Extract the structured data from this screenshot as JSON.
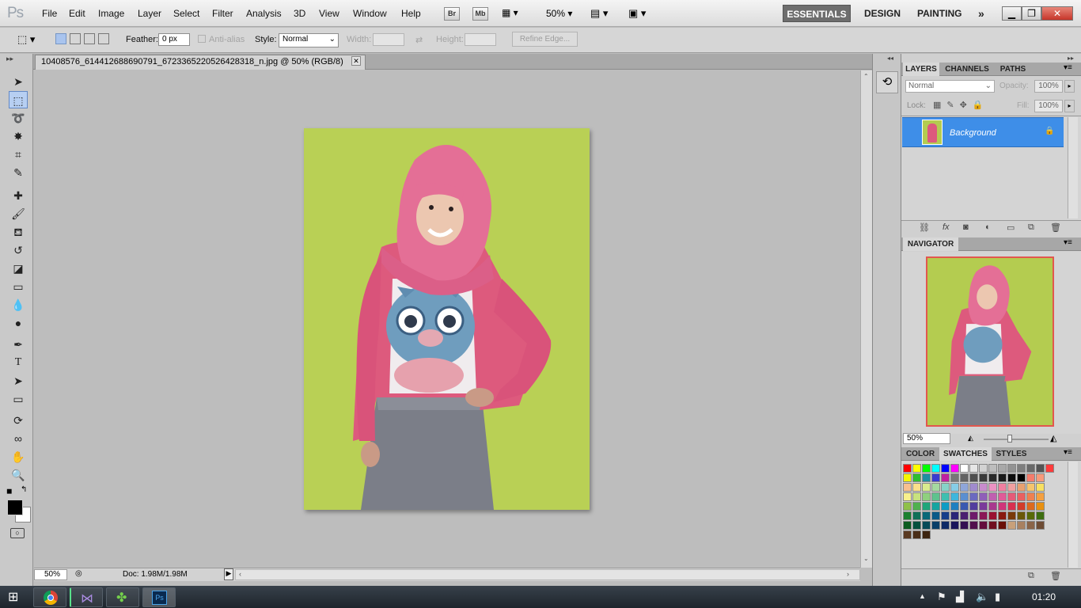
{
  "app": {
    "logo": "Ps"
  },
  "menu": [
    "File",
    "Edit",
    "Image",
    "Layer",
    "Select",
    "Filter",
    "Analysis",
    "3D",
    "View",
    "Window",
    "Help"
  ],
  "menubar_icons": {
    "bridge": "Br",
    "minibridge": "Mb",
    "zoom": "50%"
  },
  "workspaces": [
    "ESSENTIALS",
    "DESIGN",
    "PAINTING"
  ],
  "options": {
    "feather_label": "Feather:",
    "feather_value": "0 px",
    "antialias_label": "Anti-alias",
    "style_label": "Style:",
    "style_value": "Normal",
    "width_label": "Width:",
    "height_label": "Height:",
    "refine_label": "Refine Edge..."
  },
  "document": {
    "tab_title": "10408576_614412688690791_6723365220526428318_n.jpg @ 50% (RGB/8)"
  },
  "status": {
    "zoom": "50%",
    "doc": "Doc: 1.98M/1.98M"
  },
  "layers_panel": {
    "tabs": [
      "LAYERS",
      "CHANNELS",
      "PATHS"
    ],
    "blend": "Normal",
    "opacity_label": "Opacity:",
    "opacity": "100%",
    "lock_label": "Lock:",
    "fill_label": "Fill:",
    "fill": "100%",
    "layer_name": "Background"
  },
  "navigator": {
    "title": "NAVIGATOR",
    "zoom": "50%"
  },
  "swatches_panel": {
    "tabs": [
      "COLOR",
      "SWATCHES",
      "STYLES"
    ]
  },
  "taskbar": {
    "time": "01:20"
  },
  "colors": {
    "accent": "#3e8ee8",
    "canvas_bg": "#bdbdbd",
    "photo_bg": "#b4cc50"
  }
}
